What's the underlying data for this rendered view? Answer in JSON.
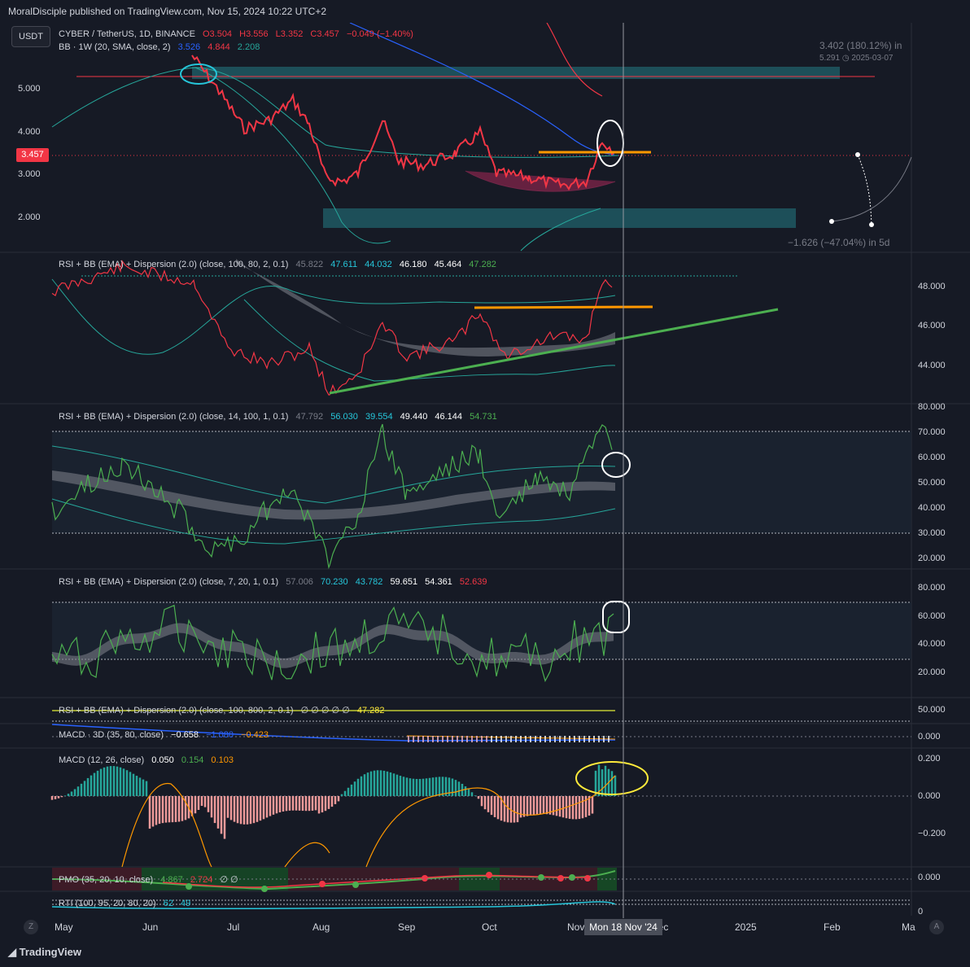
{
  "header": {
    "publisher": "MoralDisciple published on TradingView.com, Nov 15, 2024 10:22 UTC+2"
  },
  "currency_button": "USDT",
  "price_tag": "3.457",
  "main_legend": {
    "symbol": "CYBER / TetherUS, 1D, BINANCE",
    "open": "O3.504",
    "high": "H3.556",
    "low": "L3.352",
    "close": "C3.457",
    "change": "−0.049 (−1.40%)",
    "bb_title": "BB · 1W (20, SMA, close, 2)",
    "bb_basis": "3.526",
    "bb_upper": "4.844",
    "bb_lower": "2.208"
  },
  "main_axis": [
    "5.000",
    "4.000",
    "3.000",
    "2.000"
  ],
  "projection": {
    "upper_text": "3.402 (180.12%) in",
    "upper_sub": "5.291",
    "upper_date": "2025-03-07",
    "lower_text": "−1.626 (−47.04%) in 5d"
  },
  "pane_rsi100": {
    "title": "RSI + BB (EMA) + Dispersion (2.0) (close, 100, 80, 2, 0.1)",
    "values": [
      "45.822",
      "47.611",
      "44.032",
      "46.180",
      "45.464",
      "47.282"
    ],
    "axis": [
      "48.000",
      "46.000",
      "44.000"
    ]
  },
  "pane_rsi14": {
    "title": "RSI + BB (EMA) + Dispersion (2.0) (close, 14, 100, 1, 0.1)",
    "values": [
      "47.792",
      "56.030",
      "39.554",
      "49.440",
      "46.144",
      "54.731"
    ],
    "axis": [
      "80.000",
      "70.000",
      "60.000",
      "50.000",
      "40.000",
      "30.000",
      "20.000"
    ]
  },
  "pane_rsi7": {
    "title": "RSI + BB (EMA) + Dispersion (2.0) (close, 7, 20, 1, 0.1)",
    "values": [
      "57.006",
      "70.230",
      "43.782",
      "59.651",
      "54.361",
      "52.639"
    ],
    "axis": [
      "80.000",
      "60.000",
      "40.000",
      "20.000"
    ]
  },
  "pane_rsi800": {
    "title": "RSI + BB (EMA) + Dispersion (2.0) (close, 100, 800, 2, 0.1)",
    "values": "∅ ∅ ∅ ∅ ∅",
    "last": "47.282",
    "axis": "50.000"
  },
  "pane_macd3d": {
    "title": "MACD · 3D (35, 80, close)",
    "v1": "−0.658",
    "v2": "−1.080",
    "v3": "−0.423",
    "axis": "0.000"
  },
  "pane_macd": {
    "title": "MACD (12, 26, close)",
    "v1": "0.050",
    "v2": "0.154",
    "v3": "0.103",
    "axis": [
      "0.200",
      "0.000",
      "−0.200"
    ]
  },
  "pane_pmo": {
    "title": "PMO (35, 20, 10, close)",
    "v1": "4.867",
    "v2": "2.724",
    "v3": "∅ ∅",
    "axis": "0.000"
  },
  "pane_rti": {
    "title": "RTI (100, 95, 20, 80, 20)",
    "v1": "62",
    "v2": "49",
    "axis": "0"
  },
  "time_axis": [
    "May",
    "Jun",
    "Jul",
    "Aug",
    "Sep",
    "Oct",
    "Nov",
    "Dec",
    "2025",
    "Feb",
    "Ma"
  ],
  "crosshair_date": "Mon 18 Nov '24",
  "footer": {
    "brand": "TradingView"
  },
  "corner_buttons": {
    "left": "Z",
    "right": "A"
  },
  "colors": {
    "bg": "#161a25",
    "up": "#26a69a",
    "down": "#f23645",
    "orange": "#ff9800",
    "green": "#4caf50",
    "teal": "#26c6da"
  }
}
